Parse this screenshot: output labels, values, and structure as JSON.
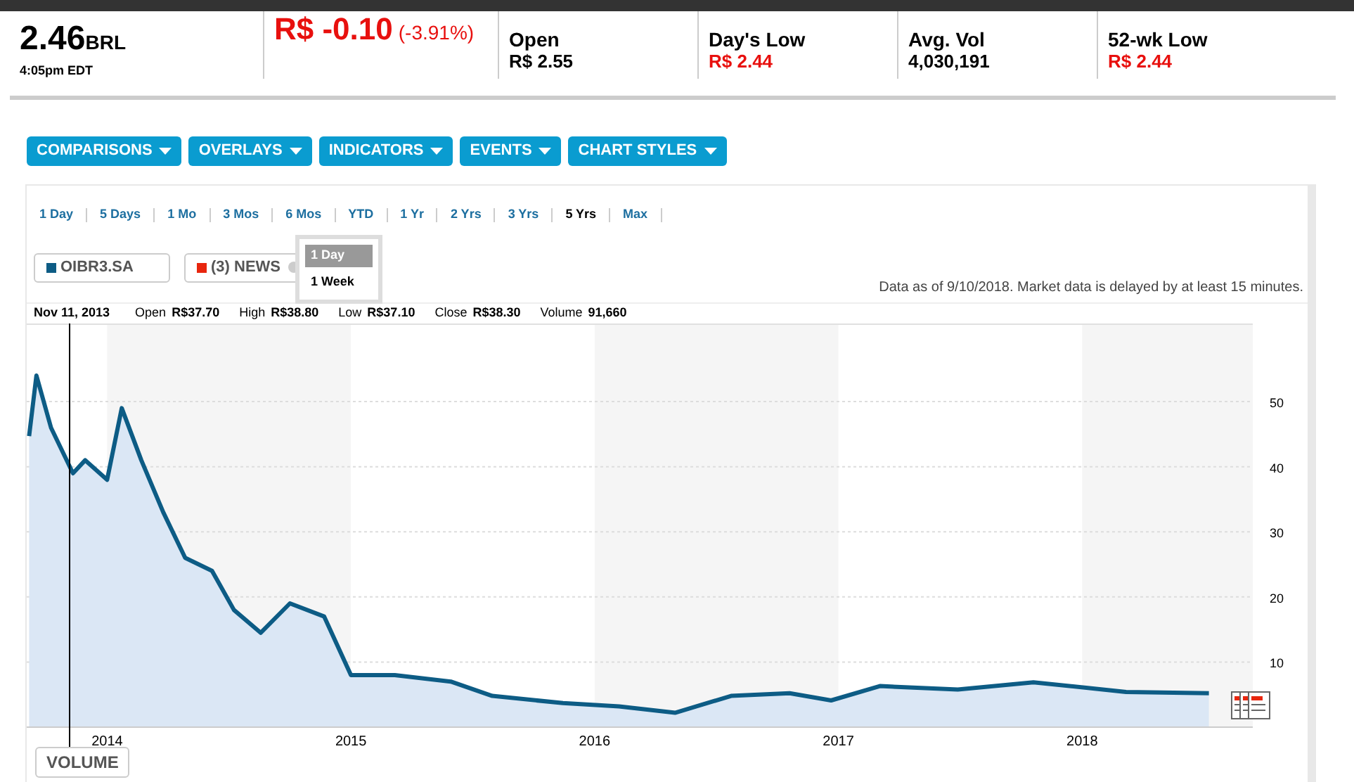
{
  "quote": {
    "price": "2.46",
    "currency": "BRL",
    "time": "4:05pm EDT",
    "change": "R$ -0.10",
    "change_pct": "(-3.91%)"
  },
  "stats": [
    {
      "label": "Open",
      "value": "R$ 2.55",
      "negative": false
    },
    {
      "label": "Day's Low",
      "value": "R$ 2.44",
      "negative": true
    },
    {
      "label": "Avg. Vol",
      "value": "4,030,191",
      "negative": false
    },
    {
      "label": "52-wk Low",
      "value": "R$ 2.44",
      "negative": true
    }
  ],
  "toolbar": [
    "COMPARISONS",
    "OVERLAYS",
    "INDICATORS",
    "EVENTS",
    "CHART STYLES"
  ],
  "ranges": [
    {
      "label": "1 Day",
      "selected": false
    },
    {
      "label": "5 Days",
      "selected": false
    },
    {
      "label": "1 Mo",
      "selected": false
    },
    {
      "label": "3 Mos",
      "selected": false
    },
    {
      "label": "6 Mos",
      "selected": false
    },
    {
      "label": "YTD",
      "selected": false
    },
    {
      "label": "1 Yr",
      "selected": false
    },
    {
      "label": "2 Yrs",
      "selected": false
    },
    {
      "label": "3 Yrs",
      "selected": false
    },
    {
      "label": "5 Yrs",
      "selected": true
    },
    {
      "label": "Max",
      "selected": false
    }
  ],
  "legend": [
    {
      "label": "(3) NEWS",
      "color": "#e8260e",
      "removable": true
    }
  ],
  "interval_menu": [
    {
      "label": "1 Day",
      "selected": true
    },
    {
      "label": "1 Week",
      "selected": false
    }
  ],
  "disclaimer": "Data as of 9/10/2018. Market data is delayed by at least 15 minutes.",
  "info": {
    "date": "Nov 11, 2013",
    "fields": [
      {
        "label": "Open",
        "value": "R$37.70"
      },
      {
        "label": "High",
        "value": "R$38.80"
      },
      {
        "label": "Low",
        "value": "R$37.10"
      },
      {
        "label": "Close",
        "value": "R$38.30"
      },
      {
        "label": "Volume",
        "value": "91,660"
      }
    ]
  },
  "chart_data": {
    "type": "area",
    "grid": true,
    "x": [
      2013.68,
      2013.71,
      2013.77,
      2013.86,
      2013.91,
      2014.0,
      2014.06,
      2014.14,
      2014.23,
      2014.32,
      2014.43,
      2014.52,
      2014.63,
      2014.75,
      2014.89,
      2015.0,
      2015.18,
      2015.41,
      2015.58,
      2015.87,
      2016.1,
      2016.33,
      2016.56,
      2016.8,
      2016.97,
      2017.17,
      2017.49,
      2017.8,
      2018.18,
      2018.52
    ],
    "series": [
      {
        "name": "OIBR3.SA",
        "color": "#0d5c85",
        "values": [
          44.7,
          54,
          46,
          39,
          41,
          38,
          49,
          41,
          33,
          26,
          24,
          18,
          14.5,
          19,
          17,
          8,
          8,
          7,
          4.8,
          3.7,
          3.2,
          2.2,
          4.8,
          5.2,
          4.1,
          6.3,
          5.8,
          6.9,
          5.4,
          5.2
        ]
      }
    ],
    "xlim": [
      2013.67,
      2018.7
    ],
    "ylim": [
      0,
      62
    ],
    "xticks": [
      2014,
      2015,
      2016,
      2017,
      2018
    ],
    "yticks": [
      10,
      20,
      30,
      40,
      50
    ]
  },
  "volume_button": "VOLUME"
}
